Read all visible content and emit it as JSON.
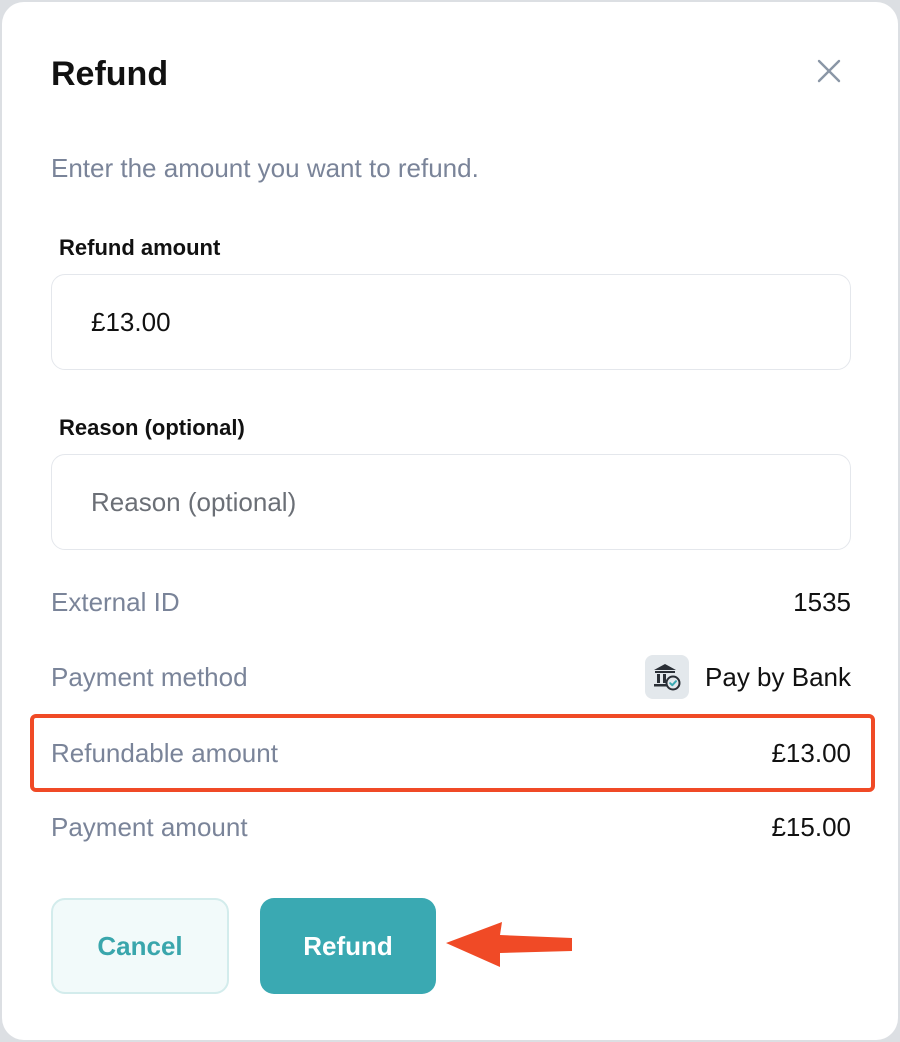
{
  "dialog": {
    "title": "Refund",
    "subtitle": "Enter the amount you want to refund."
  },
  "form": {
    "refund_amount": {
      "label": "Refund amount",
      "value": "£13.00"
    },
    "reason": {
      "label": "Reason (optional)",
      "value": "",
      "placeholder": "Reason (optional)"
    }
  },
  "details": {
    "external_id": {
      "label": "External ID",
      "value": "1535"
    },
    "payment_method": {
      "label": "Payment method",
      "value": "Pay by Bank",
      "icon": "bank-icon"
    },
    "refundable_amount": {
      "label": "Refundable amount",
      "value": "£13.00"
    },
    "payment_amount": {
      "label": "Payment amount",
      "value": "£15.00"
    }
  },
  "actions": {
    "cancel_label": "Cancel",
    "refund_label": "Refund"
  },
  "colors": {
    "accent": "#3aa9b2",
    "annotation": "#f04a26",
    "muted_text": "#7a8499"
  }
}
